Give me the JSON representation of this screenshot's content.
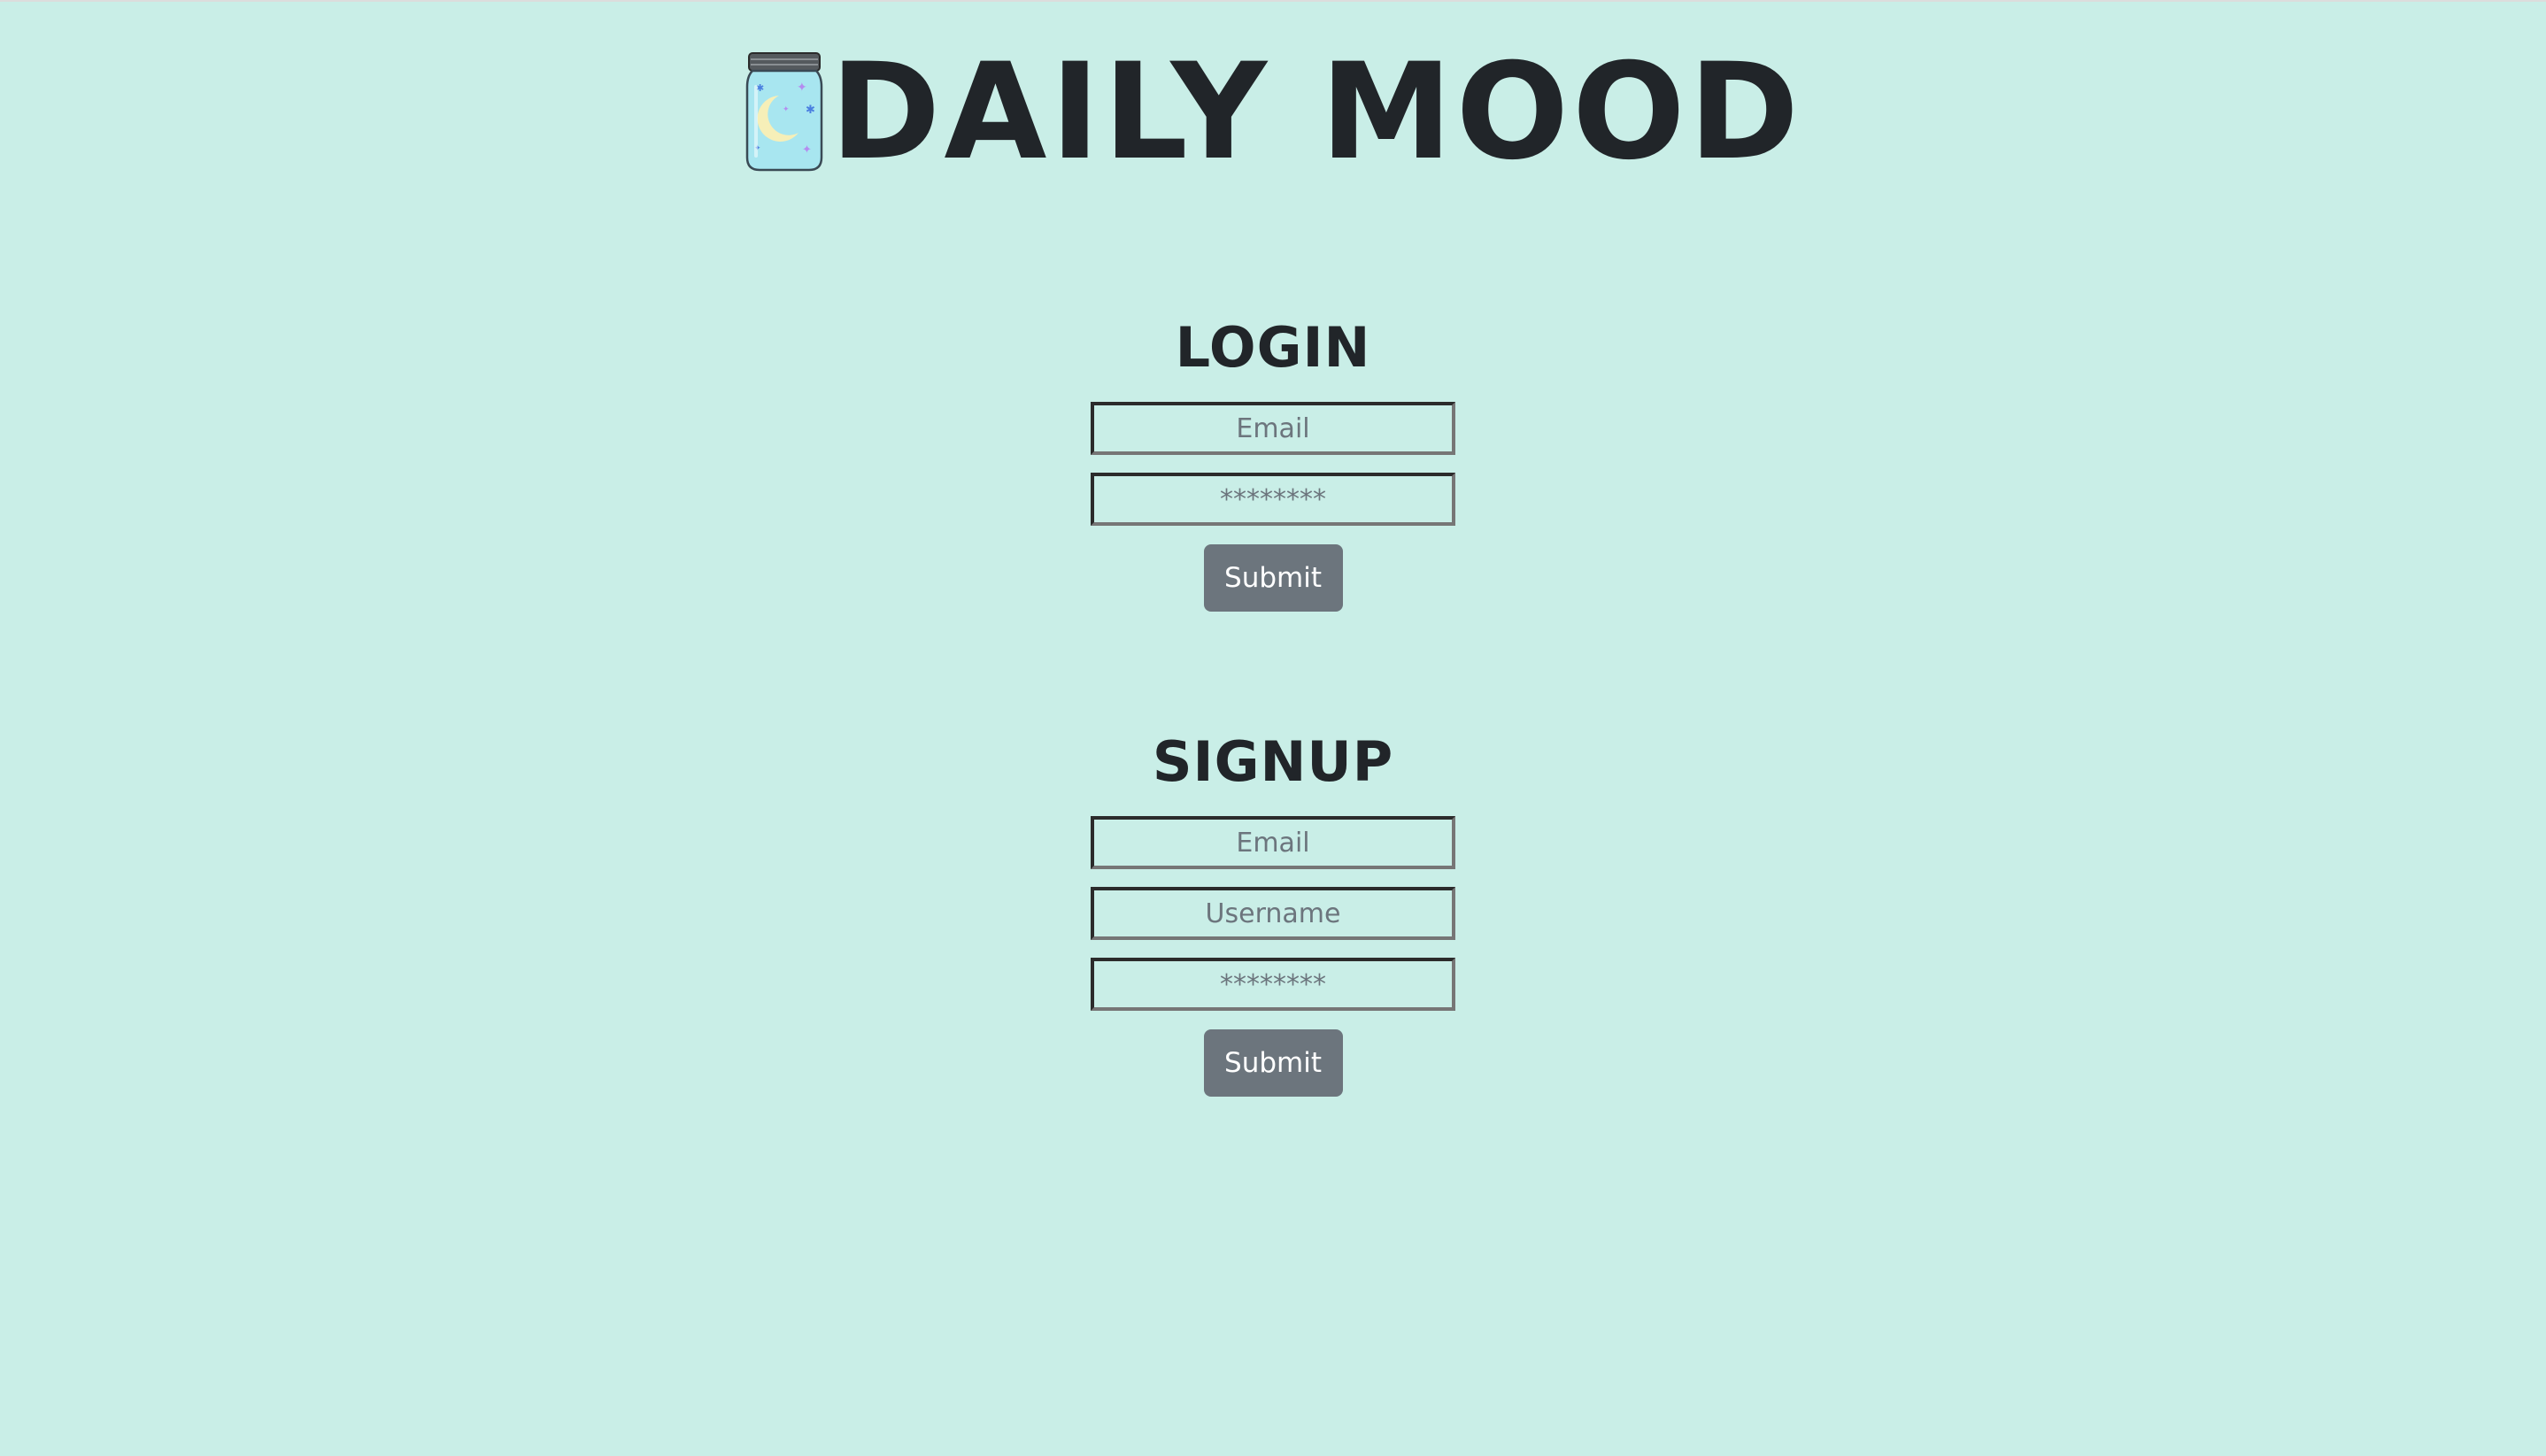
{
  "header": {
    "title": "DAILY MOOD",
    "logo_icon": "mason-jar-moon-icon"
  },
  "login": {
    "title": "LOGIN",
    "email_placeholder": "Email",
    "password_placeholder": "********",
    "submit_label": "Submit"
  },
  "signup": {
    "title": "SIGNUP",
    "email_placeholder": "Email",
    "username_placeholder": "Username",
    "password_placeholder": "********",
    "submit_label": "Submit"
  },
  "colors": {
    "background": "#c9eee7",
    "text": "#212529",
    "button": "#6c757d",
    "button_text": "#ffffff"
  }
}
